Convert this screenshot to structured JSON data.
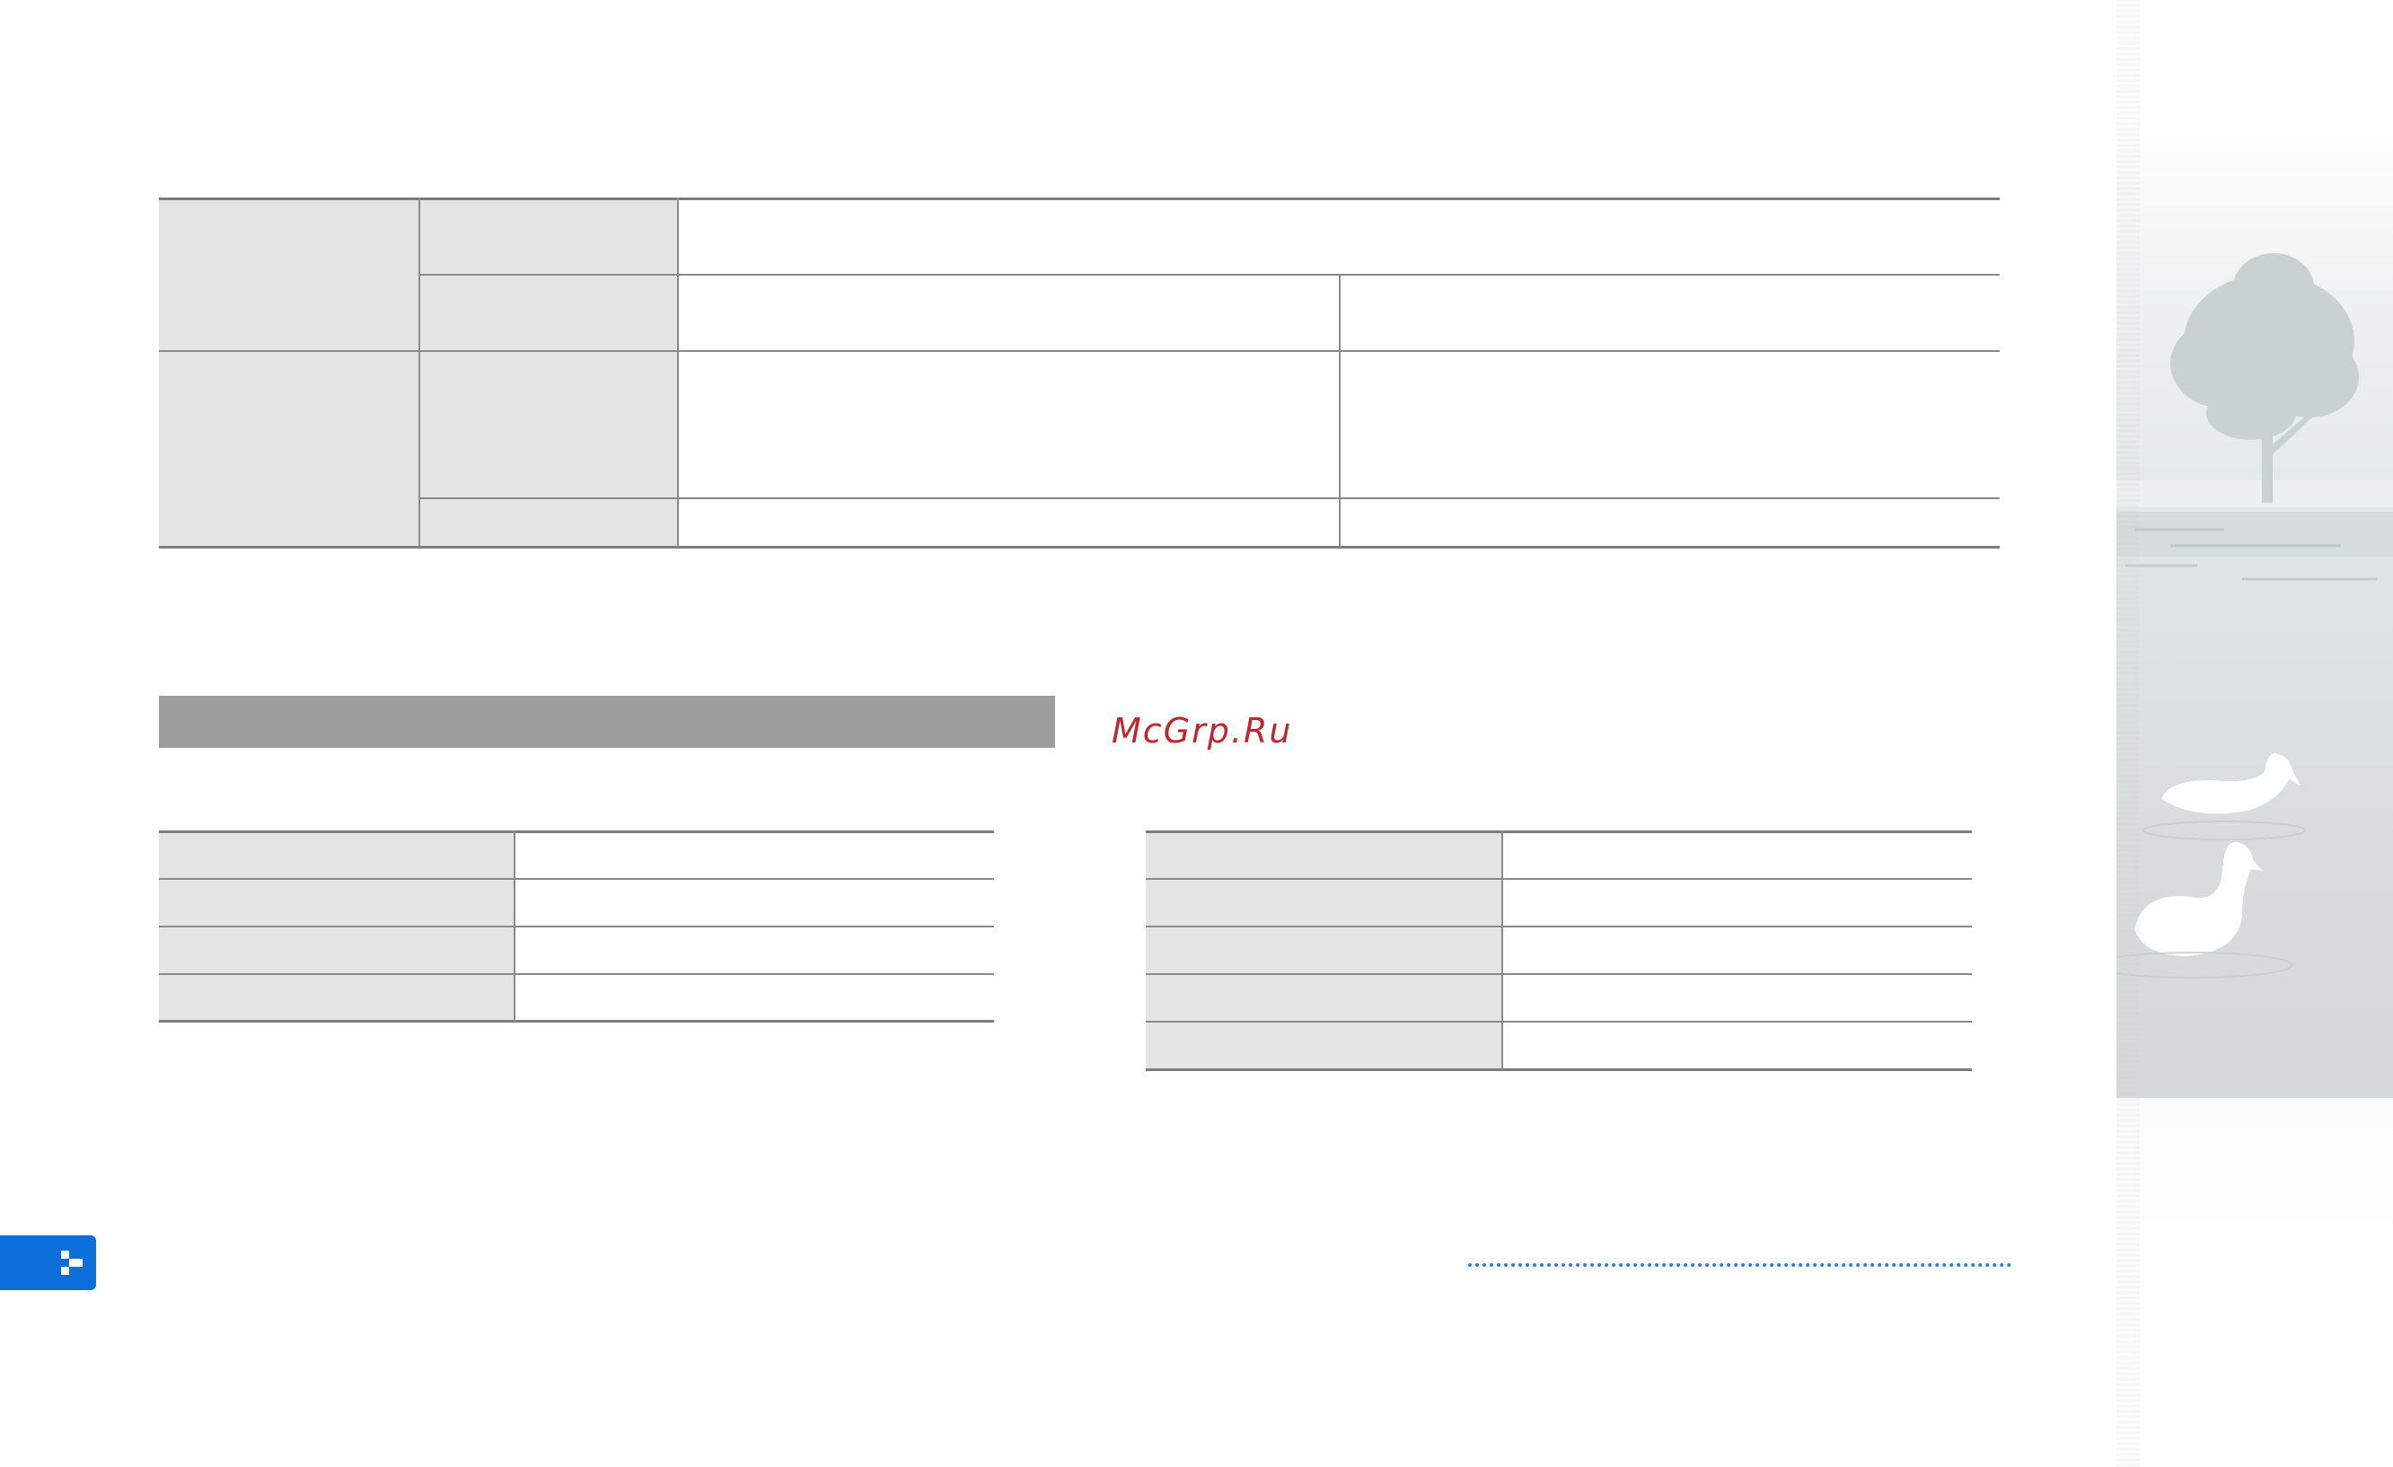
{
  "watermark": {
    "text": "McGrp.Ru",
    "color": "#c0262d"
  },
  "colors": {
    "header_cell": "#e4e4e4",
    "section_bar": "#9d9d9d",
    "page_badge": "#0a6fd8",
    "dotted_rule": "#2b7fd6"
  },
  "icons": {
    "page_badge_glyph": "checker-arrow-icon",
    "side_picture": "tree-and-swans-picture"
  }
}
